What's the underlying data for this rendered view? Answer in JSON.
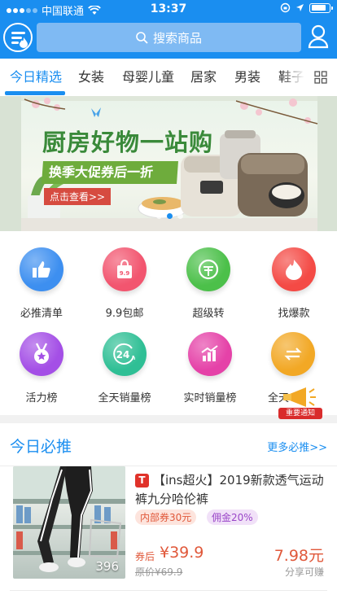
{
  "status_bar": {
    "carrier": "中国联通",
    "time": "13:37",
    "battery_level": 0.85
  },
  "header": {
    "search_placeholder": "搜索商品"
  },
  "tabs": [
    {
      "label": "今日精选",
      "active": true
    },
    {
      "label": "女装"
    },
    {
      "label": "母婴儿童"
    },
    {
      "label": "居家"
    },
    {
      "label": "男装"
    },
    {
      "label": "鞋子"
    }
  ],
  "banner": {
    "title": "厨房好物一站购",
    "subtitle": "换季大促券后一折起！",
    "button": "点击查看>>",
    "active_dot": 2,
    "dot_count": 3
  },
  "categories": [
    {
      "label": "必推清单",
      "icon": "thumbs-up-icon",
      "color": "#3d8ff0"
    },
    {
      "label": "9.9包邮",
      "icon": "shopping-bag-icon",
      "color": "#f2556f"
    },
    {
      "label": "超级转",
      "icon": "coupon-icon",
      "color": "#4cc04a"
    },
    {
      "label": "找爆款",
      "icon": "flame-icon",
      "color": "#f44a45"
    },
    {
      "label": "活力榜",
      "icon": "medal-icon",
      "color": "#a44fe6"
    },
    {
      "label": "全天销量榜",
      "icon": "24h-icon",
      "color": "#2fbf95"
    },
    {
      "label": "实时销量榜",
      "icon": "bar-chart-icon",
      "color": "#e542a8"
    },
    {
      "label": "全天",
      "icon": "exchange-icon",
      "color": "#f2a825"
    }
  ],
  "notice": {
    "tag": "重要通知"
  },
  "today": {
    "title": "今日必推",
    "more": "更多必推>>",
    "product": {
      "badge": "T",
      "title": "【ins超火】2019新款透气运动裤九分哈伦裤",
      "coupon": "内部券30元",
      "commission": "佣金20%",
      "after_label": "券后",
      "price": "¥39.9",
      "original": "原价¥69.9",
      "share": "7.98元",
      "share_label": "分享可赚",
      "image_count": "396"
    }
  }
}
